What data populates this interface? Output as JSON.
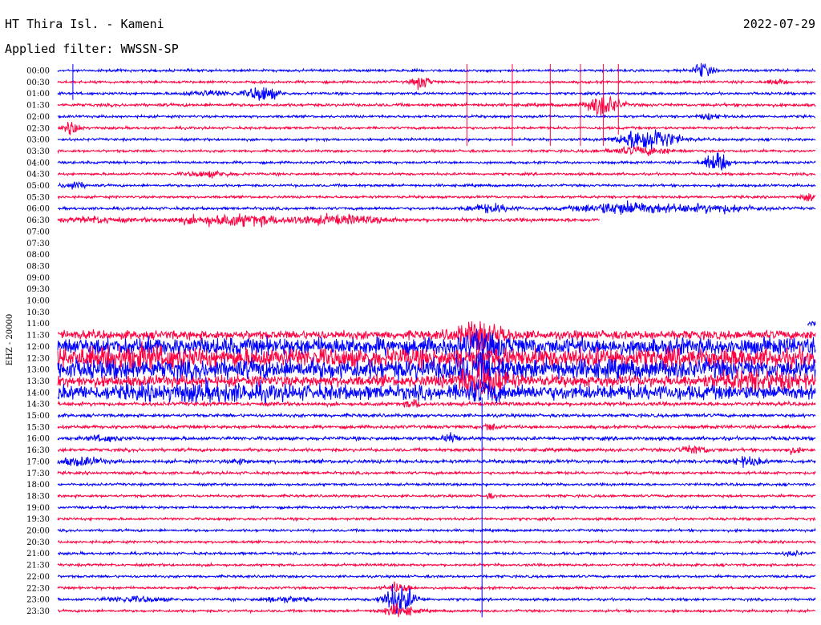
{
  "header": {
    "station": "HT Thira Isl. - Kameni",
    "date": "2022-07-29",
    "filter": "Applied filter: WWSSN-SP"
  },
  "chart_data": {
    "type": "line",
    "title": "HT Thira Isl. - Kameni",
    "subtitle": "Applied filter: WWSSN-SP",
    "date": "2022-07-29",
    "ylabel": "EHZ - 20000",
    "xlabel": "",
    "row_labels": [
      "00:00",
      "00:30",
      "01:00",
      "01:30",
      "02:00",
      "02:30",
      "03:00",
      "03:30",
      "04:00",
      "04:30",
      "05:00",
      "05:30",
      "06:00",
      "06:30",
      "07:00",
      "07:30",
      "08:00",
      "08:30",
      "09:00",
      "09:30",
      "10:00",
      "10:30",
      "11:00",
      "11:30",
      "12:00",
      "12:30",
      "13:00",
      "13:30",
      "14:00",
      "14:30",
      "15:00",
      "15:30",
      "16:00",
      "16:30",
      "17:00",
      "17:30",
      "18:00",
      "18:30",
      "19:00",
      "19:30",
      "20:00",
      "20:30",
      "21:00",
      "21:30",
      "22:00",
      "22:30",
      "23:00",
      "23:30"
    ],
    "row_minutes": 30,
    "series_colors": [
      "#0000ff",
      "#ff0040"
    ],
    "gap": {
      "from": "07:00",
      "to": "11:00"
    },
    "rows": [
      {
        "t": "00:00",
        "amp": 1.0,
        "events": [
          {
            "at": 0.85,
            "amp": 6,
            "w": 0.012
          }
        ]
      },
      {
        "t": "00:30",
        "amp": 1.0,
        "events": [
          {
            "at": 0.48,
            "amp": 5,
            "w": 0.012
          },
          {
            "at": 0.95,
            "amp": 2,
            "w": 0.01
          }
        ]
      },
      {
        "t": "01:00",
        "amp": 1.0,
        "events": [
          {
            "at": 0.27,
            "amp": 6,
            "w": 0.02
          },
          {
            "at": 0.2,
            "amp": 2,
            "w": 0.03
          }
        ]
      },
      {
        "t": "01:30",
        "amp": 1.2,
        "events": [
          {
            "at": 0.72,
            "amp": 9,
            "w": 0.02
          }
        ]
      },
      {
        "t": "02:00",
        "amp": 1.0,
        "events": [
          {
            "at": 0.86,
            "amp": 2,
            "w": 0.015
          }
        ]
      },
      {
        "t": "02:30",
        "amp": 1.0,
        "events": [
          {
            "at": 0.02,
            "amp": 5,
            "w": 0.01
          }
        ]
      },
      {
        "t": "03:00",
        "amp": 1.0,
        "events": [
          {
            "at": 0.78,
            "amp": 10,
            "w": 0.035
          }
        ]
      },
      {
        "t": "03:30",
        "amp": 1.0,
        "events": [
          {
            "at": 0.77,
            "amp": 3,
            "w": 0.04
          }
        ]
      },
      {
        "t": "04:00",
        "amp": 1.0,
        "events": [
          {
            "at": 0.87,
            "amp": 8,
            "w": 0.015
          }
        ]
      },
      {
        "t": "04:30",
        "amp": 1.0,
        "events": [
          {
            "at": 0.2,
            "amp": 2,
            "w": 0.03
          }
        ]
      },
      {
        "t": "05:00",
        "amp": 1.0,
        "events": [
          {
            "at": 0.02,
            "amp": 3,
            "w": 0.015
          }
        ]
      },
      {
        "t": "05:30",
        "amp": 1.0,
        "events": [
          {
            "at": 0.99,
            "amp": 3,
            "w": 0.008
          }
        ]
      },
      {
        "t": "06:00",
        "amp": 1.1,
        "events": [
          {
            "at": 0.57,
            "amp": 3,
            "w": 0.03
          },
          {
            "at": 0.75,
            "amp": 5,
            "w": 0.06
          },
          {
            "at": 0.87,
            "amp": 3,
            "w": 0.05
          }
        ]
      },
      {
        "t": "06:30",
        "amp": 1.4,
        "end": 0.715,
        "events": [
          {
            "at": 0.23,
            "amp": 4,
            "w": 0.07
          },
          {
            "at": 0.37,
            "amp": 3,
            "w": 0.06
          },
          {
            "at": 0.05,
            "amp": 2,
            "w": 0.03
          }
        ]
      },
      {
        "t": "07:00",
        "gap": true
      },
      {
        "t": "07:30",
        "gap": true
      },
      {
        "t": "08:00",
        "gap": true
      },
      {
        "t": "08:30",
        "gap": true
      },
      {
        "t": "09:00",
        "gap": true
      },
      {
        "t": "09:30",
        "gap": true
      },
      {
        "t": "10:00",
        "gap": true
      },
      {
        "t": "10:30",
        "gap": true
      },
      {
        "t": "11:00",
        "amp": 2.0,
        "start": 0.99,
        "events": []
      },
      {
        "t": "11:30",
        "amp": 3.5,
        "events": [
          {
            "at": 0.56,
            "amp": 12,
            "w": 0.03
          }
        ]
      },
      {
        "t": "12:00",
        "amp": 7.0,
        "events": [
          {
            "at": 0.56,
            "amp": 6,
            "w": 0.03
          }
        ]
      },
      {
        "t": "12:30",
        "amp": 8.0,
        "events": [
          {
            "at": 0.1,
            "amp": 4,
            "w": 0.05
          }
        ]
      },
      {
        "t": "13:00",
        "amp": 8.0,
        "events": [
          {
            "at": 0.55,
            "amp": 6,
            "w": 0.04
          }
        ]
      },
      {
        "t": "13:30",
        "amp": 4.5,
        "events": [
          {
            "at": 0.56,
            "amp": 14,
            "w": 0.03
          },
          {
            "at": 0.92,
            "amp": 5,
            "w": 0.06
          }
        ]
      },
      {
        "t": "14:00",
        "amp": 6.0,
        "events": [
          {
            "at": 0.2,
            "amp": 3,
            "w": 0.08
          },
          {
            "at": 0.56,
            "amp": 6,
            "w": 0.02
          }
        ]
      },
      {
        "t": "14:30",
        "amp": 1.5,
        "events": [
          {
            "at": 0.47,
            "amp": 3,
            "w": 0.01
          }
        ]
      },
      {
        "t": "15:00",
        "amp": 1.3,
        "events": []
      },
      {
        "t": "15:30",
        "amp": 1.3,
        "events": [
          {
            "at": 0.57,
            "amp": 3,
            "w": 0.01
          }
        ]
      },
      {
        "t": "16:00",
        "amp": 1.4,
        "events": [
          {
            "at": 0.52,
            "amp": 4,
            "w": 0.01
          },
          {
            "at": 0.06,
            "amp": 2,
            "w": 0.02
          }
        ]
      },
      {
        "t": "16:30",
        "amp": 1.3,
        "events": [
          {
            "at": 0.84,
            "amp": 3,
            "w": 0.02
          },
          {
            "at": 0.97,
            "amp": 2,
            "w": 0.01
          }
        ]
      },
      {
        "t": "17:00",
        "amp": 1.4,
        "events": [
          {
            "at": 0.03,
            "amp": 3,
            "w": 0.03
          },
          {
            "at": 0.91,
            "amp": 3,
            "w": 0.02
          },
          {
            "at": 0.24,
            "amp": 2,
            "w": 0.01
          }
        ]
      },
      {
        "t": "17:30",
        "amp": 1.1,
        "events": []
      },
      {
        "t": "18:00",
        "amp": 1.0,
        "events": []
      },
      {
        "t": "18:30",
        "amp": 1.0,
        "events": [
          {
            "at": 0.57,
            "amp": 2,
            "w": 0.005
          }
        ]
      },
      {
        "t": "19:00",
        "amp": 1.0,
        "events": []
      },
      {
        "t": "19:30",
        "amp": 1.0,
        "events": []
      },
      {
        "t": "20:00",
        "amp": 1.0,
        "events": []
      },
      {
        "t": "20:30",
        "amp": 1.0,
        "events": []
      },
      {
        "t": "21:00",
        "amp": 1.0,
        "events": [
          {
            "at": 0.97,
            "amp": 2,
            "w": 0.01
          }
        ]
      },
      {
        "t": "21:30",
        "amp": 1.0,
        "events": []
      },
      {
        "t": "22:00",
        "amp": 1.0,
        "events": []
      },
      {
        "t": "22:30",
        "amp": 1.0,
        "events": [
          {
            "at": 0.45,
            "amp": 4,
            "w": 0.015
          }
        ]
      },
      {
        "t": "23:00",
        "amp": 1.0,
        "events": [
          {
            "at": 0.45,
            "amp": 12,
            "w": 0.02
          },
          {
            "at": 0.1,
            "amp": 2,
            "w": 0.04
          },
          {
            "at": 0.3,
            "amp": 2,
            "w": 0.03
          }
        ]
      },
      {
        "t": "23:30",
        "amp": 1.0,
        "events": [
          {
            "at": 0.45,
            "amp": 5,
            "w": 0.02
          }
        ]
      }
    ],
    "long_spikes": [
      {
        "at": 0.54,
        "from": "00:00",
        "to": "03:00",
        "color": "#ff0040"
      },
      {
        "at": 0.6,
        "from": "00:00",
        "to": "03:00",
        "color": "#ff0040"
      },
      {
        "at": 0.65,
        "from": "00:00",
        "to": "03:00",
        "color": "#ff0040"
      },
      {
        "at": 0.69,
        "from": "00:00",
        "to": "03:00",
        "color": "#ff0040"
      },
      {
        "at": 0.72,
        "from": "00:00",
        "to": "03:00",
        "color": "#ff0040"
      },
      {
        "at": 0.74,
        "from": "00:00",
        "to": "02:30",
        "color": "#ff0040"
      },
      {
        "at": 0.56,
        "from": "14:30",
        "to": "23:30",
        "color": "#0000ff"
      },
      {
        "at": 0.02,
        "from": "00:00",
        "to": "01:00",
        "color": "#0000ff"
      }
    ]
  }
}
